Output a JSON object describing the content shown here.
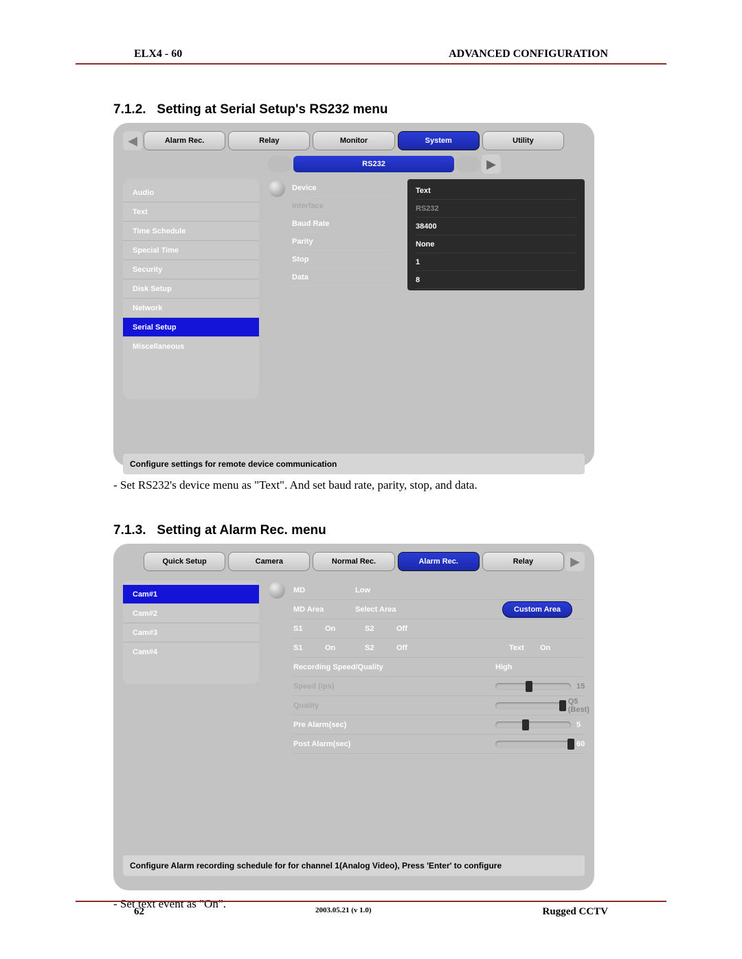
{
  "header": {
    "left": "ELX4 - 60",
    "right": "ADVANCED CONFIGURATION"
  },
  "sec1": {
    "num": "7.1.2.",
    "title": "Setting at Serial Setup's RS232 menu",
    "tabs": [
      "Alarm Rec.",
      "Relay",
      "Monitor",
      "System",
      "Utility"
    ],
    "tab_selected": "System",
    "subtab": "RS232",
    "sidebar": [
      "Audio",
      "Text",
      "Time Schedule",
      "Special Time",
      "Security",
      "Disk Setup",
      "Network",
      "Serial Setup",
      "Miscellaneous"
    ],
    "sidebar_selected": "Serial Setup",
    "rows": [
      {
        "k": "Device",
        "v": "Text",
        "dim": false
      },
      {
        "k": "Interface",
        "v": "RS232",
        "dim": true
      },
      {
        "k": "Baud Rate",
        "v": "38400",
        "dim": false
      },
      {
        "k": "Parity",
        "v": "None",
        "dim": false
      },
      {
        "k": "Stop",
        "v": "1",
        "dim": false
      },
      {
        "k": "Data",
        "v": "8",
        "dim": false
      }
    ],
    "hint": "Configure settings for remote device communication",
    "note": "- Set RS232's device menu as  \"Text\". And set baud rate, parity, stop, and data."
  },
  "sec2": {
    "num": "7.1.3.",
    "title": "Setting at Alarm Rec. menu",
    "tabs": [
      "Quick Setup",
      "Camera",
      "Normal Rec.",
      "Alarm Rec.",
      "Relay"
    ],
    "tab_selected": "Alarm Rec.",
    "sidebar": [
      "Cam#1",
      "Cam#2",
      "Cam#3",
      "Cam#4"
    ],
    "sidebar_selected": "Cam#1",
    "r_md": {
      "lbl": "MD",
      "val": "Low"
    },
    "r_mdarea": {
      "lbl": "MD Area",
      "val": "Select Area",
      "btn": "Custom Area"
    },
    "r_s1a": {
      "a": "S1",
      "av": "On",
      "b": "S2",
      "bv": "Off"
    },
    "r_s1b": {
      "a": "S1",
      "av": "On",
      "b": "S2",
      "bv": "Off",
      "tlabel": "Text",
      "tval": "On"
    },
    "r_rsq": {
      "lbl": "Recording Speed/Quality",
      "val": "High"
    },
    "r_speed": {
      "lbl": "Speed (ips)",
      "val": "15",
      "pct": 40
    },
    "r_quality": {
      "lbl": "Quality",
      "val": "Q5 (Best)",
      "pct": 95
    },
    "r_pre": {
      "lbl": "Pre Alarm(sec)",
      "val": "5",
      "pct": 35
    },
    "r_post": {
      "lbl": "Post Alarm(sec)",
      "val": "60",
      "pct": 95
    },
    "hint": "Configure Alarm recording schedule for for channel 1(Analog Video), Press 'Enter' to configure",
    "note": "- Set text event as  \"On\"."
  },
  "footer": {
    "page": "62",
    "date": "2003.05.21 (v 1.0)",
    "brand": "Rugged CCTV"
  }
}
